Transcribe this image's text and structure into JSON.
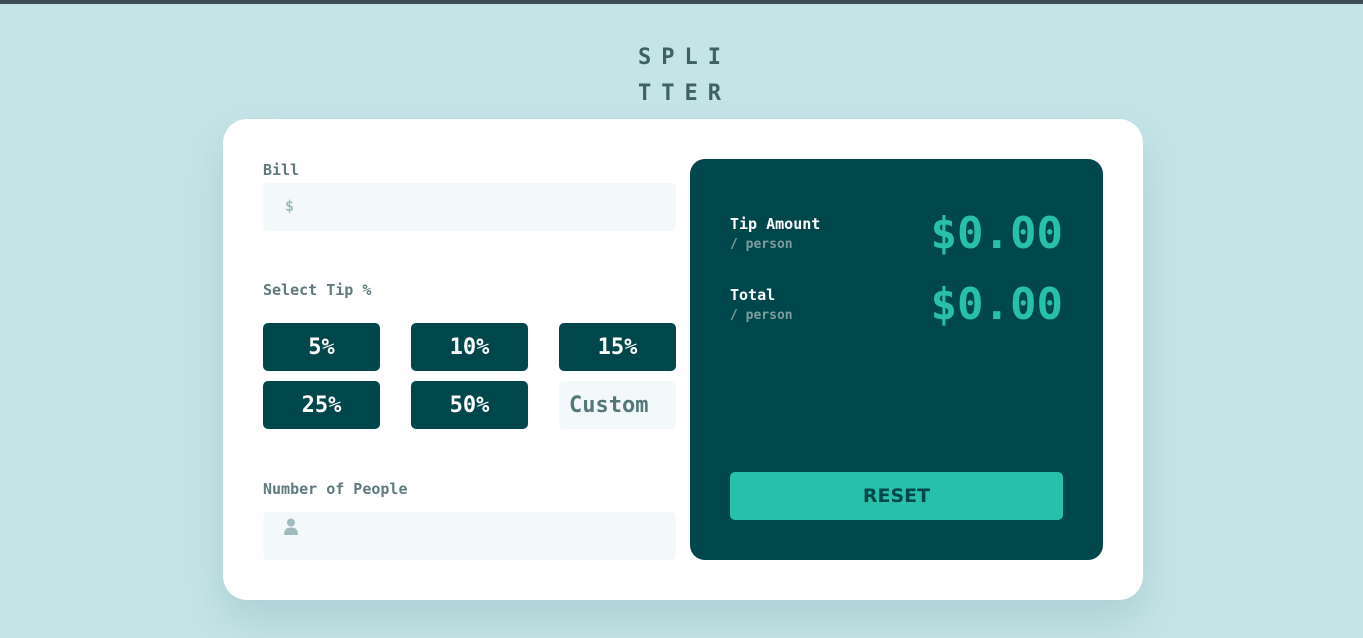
{
  "logo": {
    "line1": "SPLI",
    "line2": "TTER"
  },
  "bill": {
    "label": "Bill",
    "currency_symbol": "$",
    "value": ""
  },
  "tip": {
    "label": "Select Tip %",
    "options": [
      "5%",
      "10%",
      "15%",
      "25%",
      "50%"
    ],
    "custom_placeholder": "Custom"
  },
  "people": {
    "label": "Number of People",
    "value": ""
  },
  "results": {
    "tip_amount": {
      "title": "Tip Amount",
      "sub": "/ person",
      "value": "$0.00"
    },
    "total": {
      "title": "Total",
      "sub": "/ person",
      "value": "$0.00"
    },
    "reset_label": "RESET"
  },
  "colors": {
    "background": "#c5e4e7",
    "dark_cyan": "#00474b",
    "accent": "#26c0ab",
    "input_bg": "#f3f9fa"
  },
  "icons": {
    "person": "person-icon"
  }
}
